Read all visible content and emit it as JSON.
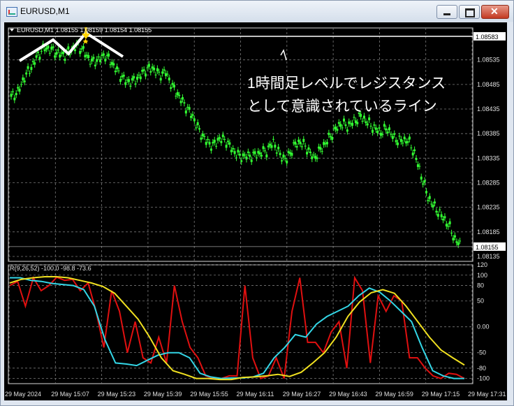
{
  "window": {
    "title": "EURUSD,M1",
    "min_icon": "minimize-icon",
    "max_icon": "maximize-icon",
    "close_icon": "close-icon",
    "close_glyph": "✕"
  },
  "chart_header": {
    "symbol_line": "EURUSD,M1  1.08155 1.08159 1.08154 1.08155"
  },
  "annotation": {
    "line1": "1時間足レベルでレジスタンス",
    "line2": "として意識されているライン"
  },
  "labels": {
    "resistance_price": "1.08583",
    "current_price": "1.08155",
    "oscillator_title": "R(9,26,52) -100.0 -98.8 -73.6"
  },
  "colors": {
    "bullish_candles": "#33ff33",
    "oscillator_fast": "#e01010",
    "oscillator_mid": "#33d6e6",
    "oscillator_slow": "#f0e020",
    "resistance_line": "#ffffff",
    "marker": "#ffd400"
  },
  "chart_data": [
    {
      "type": "line",
      "title": "EURUSD,M1",
      "x": [
        "29 May 2024",
        "29 May 15:07",
        "29 May 15:23",
        "29 May 15:39",
        "29 May 15:55",
        "29 May 16:11",
        "29 May 16:27",
        "29 May 16:43",
        "29 May 16:59",
        "29 May 17:15",
        "29 May 17:31"
      ],
      "y_ticks": [
        "1.08535",
        "1.08485",
        "1.08435",
        "1.08385",
        "1.08335",
        "1.08285",
        "1.08235",
        "1.08185",
        "1.08135"
      ],
      "ylim": [
        1.08125,
        1.086
      ],
      "series": [
        {
          "name": "EURUSD",
          "points": [
            [
              0,
              1.0846
            ],
            [
              2,
              1.0847
            ],
            [
              4,
              1.085
            ],
            [
              6,
              1.0852
            ],
            [
              8,
              1.08545
            ],
            [
              10,
              1.0856
            ],
            [
              12,
              1.08555
            ],
            [
              14,
              1.08548
            ],
            [
              16,
              1.08545
            ],
            [
              18,
              1.08556
            ],
            [
              20,
              1.08565
            ],
            [
              22,
              1.08548
            ],
            [
              24,
              1.0853
            ],
            [
              26,
              1.08536
            ],
            [
              28,
              1.08545
            ],
            [
              30,
              1.08528
            ],
            [
              32,
              1.08508
            ],
            [
              34,
              1.08492
            ],
            [
              36,
              1.0849
            ],
            [
              38,
              1.085
            ],
            [
              40,
              1.08515
            ],
            [
              42,
              1.08518
            ],
            [
              44,
              1.08505
            ],
            [
              46,
              1.0851
            ],
            [
              48,
              1.0848
            ],
            [
              50,
              1.0846
            ],
            [
              52,
              1.0844
            ],
            [
              54,
              1.0842
            ],
            [
              56,
              1.0839
            ],
            [
              58,
              1.0837
            ],
            [
              60,
              1.0836
            ],
            [
              62,
              1.08375
            ],
            [
              64,
              1.0837
            ],
            [
              66,
              1.0835
            ],
            [
              68,
              1.08338
            ],
            [
              70,
              1.0834
            ],
            [
              72,
              1.0834
            ],
            [
              74,
              1.08345
            ],
            [
              76,
              1.0835
            ],
            [
              78,
              1.08368
            ],
            [
              80,
              1.0834
            ],
            [
              82,
              1.08332
            ],
            [
              84,
              1.0836
            ],
            [
              86,
              1.08368
            ],
            [
              88,
              1.08355
            ],
            [
              90,
              1.08335
            ],
            [
              92,
              1.08352
            ],
            [
              94,
              1.0837
            ],
            [
              96,
              1.0839
            ],
            [
              98,
              1.08405
            ],
            [
              100,
              1.084
            ],
            [
              102,
              1.0841
            ],
            [
              104,
              1.0842
            ],
            [
              106,
              1.08408
            ],
            [
              108,
              1.08396
            ],
            [
              110,
              1.08388
            ],
            [
              112,
              1.08395
            ],
            [
              114,
              1.08375
            ],
            [
              116,
              1.0837
            ],
            [
              118,
              1.08372
            ],
            [
              120,
              1.08345
            ],
            [
              122,
              1.083
            ],
            [
              124,
              1.08255
            ],
            [
              126,
              1.08235
            ],
            [
              128,
              1.08218
            ],
            [
              130,
              1.082
            ],
            [
              132,
              1.0817
            ],
            [
              134,
              1.08155
            ]
          ]
        }
      ],
      "annotations": [
        "1時間足レベルでレジスタンスとして意識されているライン"
      ],
      "hlines": [
        1.08583,
        1.08155
      ]
    },
    {
      "type": "line",
      "title": "R(9,26,52) -100.0 -98.8 -73.6",
      "y_ticks": [
        "120",
        "100",
        "80",
        "50",
        "0.00",
        "-50",
        "-80",
        "-100"
      ],
      "ylim": [
        -110,
        120
      ],
      "series": [
        {
          "name": "R9",
          "values": [
            80,
            88,
            40,
            95,
            70,
            80,
            96,
            90,
            92,
            70,
            85,
            30,
            -40,
            70,
            30,
            -50,
            10,
            -60,
            -70,
            -20,
            -70,
            80,
            10,
            -40,
            -60,
            -95,
            -100,
            -100,
            -95,
            -95,
            80,
            -60,
            -100,
            -95,
            -60,
            -100,
            30,
            95,
            -30,
            -30,
            -50,
            -10,
            10,
            -80,
            95,
            70,
            -70,
            60,
            30,
            60,
            50,
            -60,
            -60,
            -80,
            -95,
            -100,
            -90,
            -92,
            -100
          ]
        },
        {
          "name": "R26",
          "values": [
            95,
            95,
            90,
            88,
            84,
            82,
            80,
            72,
            40,
            -25,
            -70,
            -72,
            -75,
            -65,
            -55,
            -50,
            -50,
            -60,
            -90,
            -97,
            -100,
            -99,
            -99,
            -97,
            -90,
            -60,
            -40,
            -15,
            -20,
            5,
            20,
            30,
            40,
            60,
            75,
            67,
            50,
            30,
            10,
            -40,
            -85,
            -95,
            -100,
            -100
          ]
        },
        {
          "name": "R52",
          "values": [
            85,
            92,
            95,
            97,
            97,
            95,
            90,
            85,
            78,
            65,
            40,
            15,
            -20,
            -60,
            -85,
            -92,
            -100,
            -100,
            -102,
            -102,
            -98,
            -97,
            -95,
            -92,
            -96,
            -88,
            -70,
            -50,
            -20,
            20,
            48,
            66,
            72,
            65,
            40,
            10,
            -20,
            -45,
            -60,
            -74
          ]
        }
      ]
    }
  ]
}
